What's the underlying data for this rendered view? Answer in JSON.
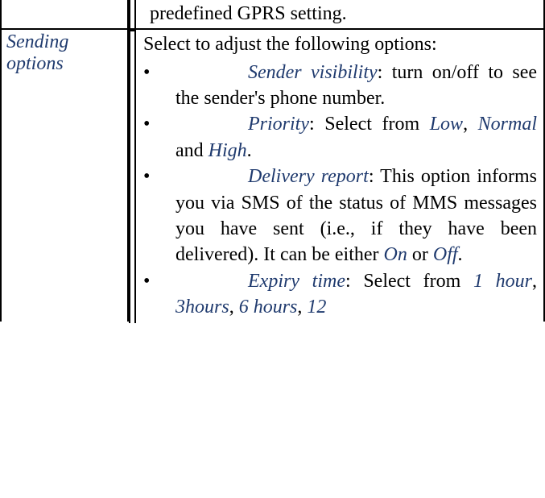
{
  "rows": [
    {
      "left": "",
      "right_plain": "predefined GPRS setting."
    },
    {
      "left": "Sending options",
      "intro": "Select to adjust the following options:",
      "items": [
        {
          "term": "Sender visibility",
          "rest": ": turn on/off to see the sender's phone number."
        },
        {
          "term": "Priority",
          "rest_prefix": ": Select from ",
          "opt1": "Low",
          "sep1": ", ",
          "opt2": "Normal",
          "sep2": " and ",
          "opt3": "High",
          "rest_suffix": "."
        },
        {
          "term": "Delivery report",
          "rest_prefix": ": This option informs you via SMS of the status of MMS messages you have sent (i.e., if they have been delivered). It can be either ",
          "opt1": "On",
          "sep1": " or ",
          "opt2": "Off",
          "rest_suffix": "."
        },
        {
          "term": "Expiry time",
          "rest_prefix": ": Select from ",
          "opt1": "1 hour",
          "sep1": ", ",
          "opt2": "3hours",
          "sep2": ", ",
          "opt3": "6 hours",
          "sep3": ", ",
          "opt4": "12"
        }
      ]
    }
  ]
}
